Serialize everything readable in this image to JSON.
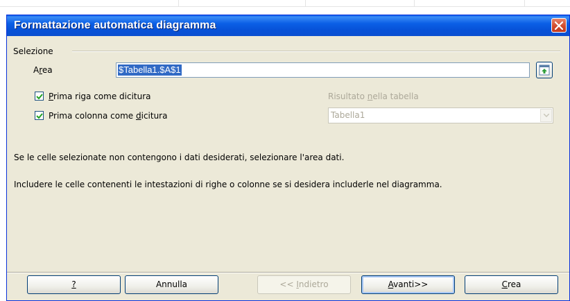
{
  "dialog": {
    "title": "Formattazione automatica diagramma",
    "close_icon": "close-icon"
  },
  "selection_group": {
    "label": "Selezione",
    "area_label_pre": "A",
    "area_label_accel": "r",
    "area_label_post": "ea",
    "area_value": "$Tabella1.$A$1",
    "shrink_icon": "shrink-range-icon"
  },
  "options": {
    "first_row": {
      "accel": "P",
      "rest": "rima riga come dicitura",
      "checked": true
    },
    "first_col": {
      "pre": "Prima colonna come ",
      "accel": "d",
      "rest": "icitura",
      "checked": true
    }
  },
  "result": {
    "label_pre": "Risultato ",
    "label_accel": "n",
    "label_post": "ella tabella",
    "value": "Tabella1"
  },
  "info": {
    "line1": "Se le celle selezionate non contengono i dati desiderati, selezionare l'area dati.",
    "line2": "Includere le celle contenenti le intestazioni di righe o colonne se si desidera includerle nel diagramma."
  },
  "buttons": {
    "help": "?",
    "cancel": "Annulla",
    "back_pre": "<< ",
    "back_accel": "I",
    "back_post": "ndietro",
    "next_accel": "A",
    "next_post": "vanti>>",
    "create_accel": "C",
    "create_post": "rea"
  },
  "colors": {
    "title_bar": "#0a5ae8",
    "selection_highlight": "#316ac5",
    "dialog_bg": "#ece9d8"
  }
}
